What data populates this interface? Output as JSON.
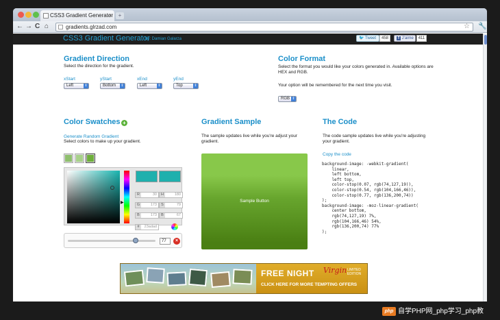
{
  "browser": {
    "tab_title": "CSS3 Gradient Generator",
    "tab_close": "×",
    "new_tab": "+",
    "url": "gradients.glrzad.com",
    "back": "←",
    "forward": "→",
    "reload": "C",
    "home": "⌂",
    "star": "☆",
    "wrench": "🔧"
  },
  "site": {
    "logo": "CSS3 Gradient Generator",
    "byline": "by: Damian Galarza",
    "tweet_label": "Tweet",
    "tweet_count": "458",
    "like_label": "J'aime",
    "like_count": "411"
  },
  "direction": {
    "title": "Gradient Direction",
    "subtitle": "Select the direction for the gradient.",
    "fields": [
      {
        "label": "xStart",
        "value": "Left"
      },
      {
        "label": "yStart",
        "value": "Bottom"
      },
      {
        "label": "xEnd",
        "value": "Left"
      },
      {
        "label": "yEnd",
        "value": "Top"
      }
    ]
  },
  "format": {
    "title": "Color Format",
    "desc": "Select the format you would like your colors generated in. Available options are HEX and RGB.",
    "note": "Your option will be remembered for the next time you visit.",
    "value": "RGB"
  },
  "swatches": {
    "title": "Color Swatches",
    "random_link": "Generate Random Gradient",
    "subtitle": "Select colors to make up your gradient.",
    "colors": [
      "#8fbf6e",
      "#a8d18a",
      "#6faf3c"
    ],
    "channels": {
      "r": {
        "label": "R",
        "value": "30"
      },
      "g": {
        "label": "G",
        "value": "173"
      },
      "b": {
        "label": "B",
        "value": "173"
      },
      "h": {
        "label": "H",
        "value": "180"
      },
      "s": {
        "label": "S",
        "value": "79"
      },
      "bb": {
        "label": "B",
        "value": "67"
      },
      "hex": {
        "label": "#",
        "value": "23adad"
      }
    },
    "stop_position": "77",
    "stop_position_fraction": 0.77,
    "remove": "×"
  },
  "sample": {
    "title": "Gradient Sample",
    "desc": "The sample updates live while you're adjust your gradient.",
    "button_text": "Sample Button"
  },
  "code": {
    "title": "The Code",
    "desc": "The code sample updates live while you're adjusting your gradient.",
    "copy_link": "Copy the code",
    "text": "background-image: -webkit-gradient(\n    linear,\n    left bottom,\n    left top,\n    color-stop(0.07, rgb(74,127,19)),\n    color-stop(0.54, rgb(104,166,46)),\n    color-stop(0.77, rgb(136,200,74))\n);\nbackground-image: -moz-linear-gradient(\n    center bottom,\n    rgb(74,127,19) 7%,\n    rgb(104,166,46) 54%,\n    rgb(136,200,74) 77%\n);"
  },
  "ad": {
    "title": "FREE NIGHT",
    "cta": "CLICK HERE FOR MORE TEMPTING OFFERS",
    "brand": "Virgin",
    "badge": "LIMITED EDITION"
  },
  "watermark": {
    "logo": "php",
    "text": "自学PHP网_php学习_php教"
  },
  "colors": {
    "accent_blue": "#1b8fc9",
    "header_bg": "#1f1f1f",
    "picker_color": "#1fb0ad"
  }
}
